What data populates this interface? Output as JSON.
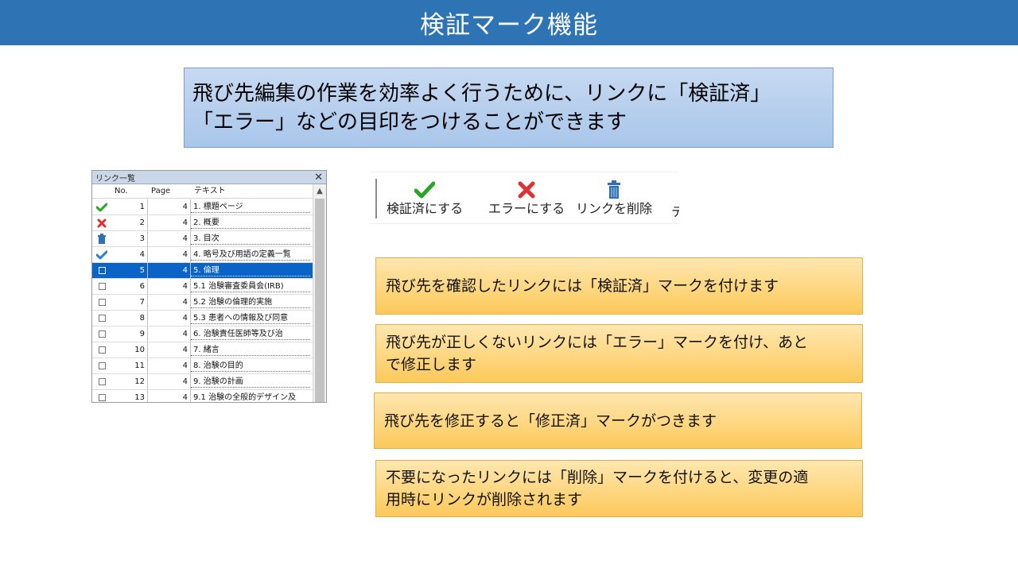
{
  "header": {
    "title": "検証マーク機能"
  },
  "intro": {
    "line1": "飛び先編集の作業を効率よく行うために、リンクに「検証済」",
    "line2": "「エラー」などの目印をつけることができます"
  },
  "link_panel": {
    "title": "リンク一覧",
    "columns": {
      "no": "No.",
      "page": "Page",
      "text": "テキスト"
    },
    "rows": [
      {
        "mark": "verified-icon",
        "no": "1",
        "page": "4",
        "text": "1. 標題ページ",
        "selected": false
      },
      {
        "mark": "error-icon",
        "no": "2",
        "page": "4",
        "text": "2. 概要",
        "selected": false
      },
      {
        "mark": "delete-icon",
        "no": "3",
        "page": "4",
        "text": "3. 目次",
        "selected": false
      },
      {
        "mark": "fixed-icon",
        "no": "4",
        "page": "4",
        "text": "4. 略号及び用語の定義一覧",
        "selected": false
      },
      {
        "mark": "checkbox",
        "no": "5",
        "page": "4",
        "text": "5. 倫理",
        "selected": true
      },
      {
        "mark": "checkbox",
        "no": "6",
        "page": "4",
        "text": "5.1 治験審査委員会(IRB)",
        "selected": false
      },
      {
        "mark": "checkbox",
        "no": "7",
        "page": "4",
        "text": "5.2 治験の倫理的実施",
        "selected": false
      },
      {
        "mark": "checkbox",
        "no": "8",
        "page": "4",
        "text": "5.3 患者への情報及び同意",
        "selected": false
      },
      {
        "mark": "checkbox",
        "no": "9",
        "page": "4",
        "text": "6. 治験責任医師等及び治",
        "selected": false
      },
      {
        "mark": "checkbox",
        "no": "10",
        "page": "4",
        "text": "7. 緒言",
        "selected": false
      },
      {
        "mark": "checkbox",
        "no": "11",
        "page": "4",
        "text": "8. 治験の目的",
        "selected": false
      },
      {
        "mark": "checkbox",
        "no": "12",
        "page": "4",
        "text": "9. 治験の計画",
        "selected": false
      },
      {
        "mark": "checkbox",
        "no": "13",
        "page": "4",
        "text": "9.1 治験の全般的デザイン及",
        "selected": false
      }
    ]
  },
  "toolbar": {
    "verify_label": "検証済にする",
    "error_label": "エラーにする",
    "delete_label": "リンクを削除",
    "cut_label": "テ"
  },
  "notes": {
    "verified": "飛び先を確認したリンクには「検証済」マークを付けます",
    "error_line1": "飛び先が正しくないリンクには「エラー」マークを付け、あと",
    "error_line2": "で修正します",
    "fixed": "飛び先を修正すると「修正済」マークがつきます",
    "delete_line1": "不要になったリンクには「削除」マークを付けると、変更の適",
    "delete_line2": "用時にリンクが削除されます"
  },
  "colors": {
    "title_bar": "#2e74b5",
    "intro_bg": "#b4cdee",
    "note_bg": "#fdd98a",
    "check_green": "#2aa52a",
    "error_red": "#e03030",
    "trash_blue": "#2f6fb3",
    "fixed_blue": "#2a7fd4",
    "selected_row": "#0a64c8"
  }
}
